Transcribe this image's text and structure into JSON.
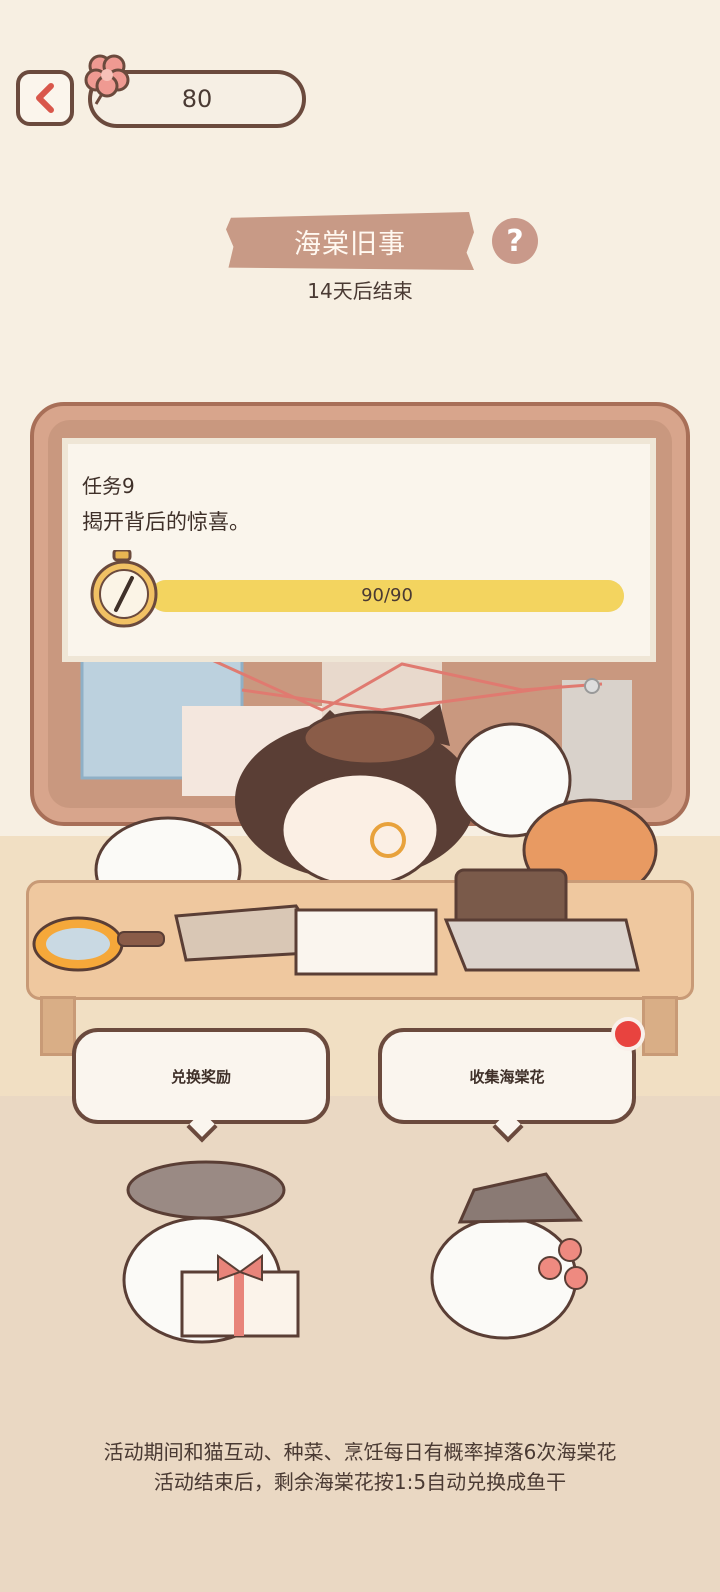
{
  "header": {
    "currency_value": "80"
  },
  "event": {
    "title": "海棠旧事",
    "subtitle": "14天后结束",
    "help_symbol": "?"
  },
  "task": {
    "title": "任务9",
    "description": "揭开背后的惊喜。",
    "progress_text": "90/90",
    "progress_fraction": 1.0
  },
  "actions": {
    "exchange_label": "兑换奖励",
    "collect_label": "收集海棠花"
  },
  "footer": {
    "line1": "活动期间和猫互动、种菜、烹饪每日有概率掉落6次海棠花",
    "line2": "活动结束后，剩余海棠花按1:5自动兑换成鱼干"
  },
  "colors": {
    "accent_red": "#e8433f",
    "progress_yellow": "#f3d45f",
    "banner": "#c89a86"
  }
}
